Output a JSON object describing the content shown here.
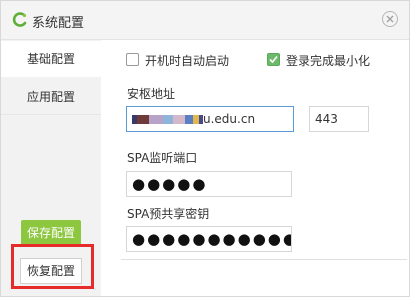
{
  "window": {
    "title": "系统配置"
  },
  "sidebar": {
    "items": [
      {
        "label": "基础配置",
        "active": true
      },
      {
        "label": "应用配置",
        "active": false
      }
    ],
    "save_label": "保存配置",
    "restore_label": "恢复配置"
  },
  "options": {
    "autostart": {
      "label": "开机时自动启动",
      "checked": false
    },
    "minimize_after_login": {
      "label": "登录完成最小化",
      "checked": true
    }
  },
  "server": {
    "address_label": "安枢地址",
    "address_value": "u.edu.cn",
    "port_value": "443"
  },
  "spa_port": {
    "label": "SPA监听端口",
    "value": "●●●●●"
  },
  "spa_key": {
    "label": "SPA预共享密钥",
    "value": "●●●●●●●●●●●"
  },
  "colors": {
    "accent_green": "#8dc63f",
    "highlight_red": "#e62b2b",
    "check_green": "#6cb96c"
  },
  "icons": {
    "logo": "app-logo-icon",
    "close": "close-icon",
    "check": "check-icon"
  }
}
